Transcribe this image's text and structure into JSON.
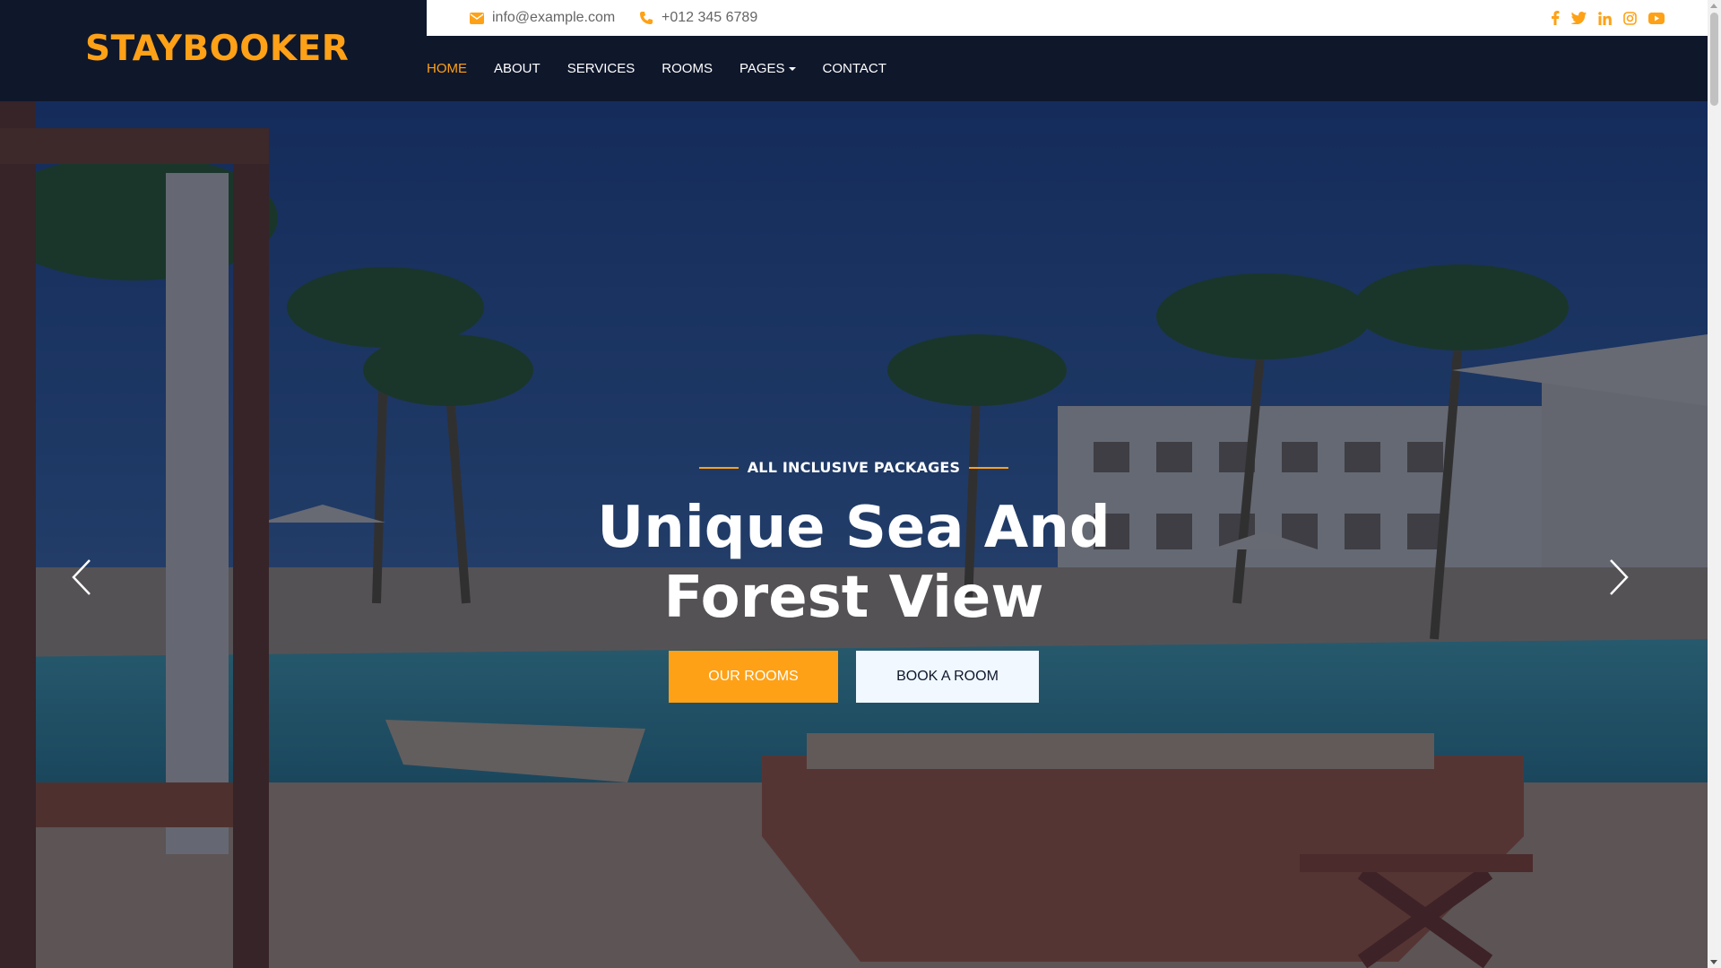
{
  "brand": "STAYBOOKER",
  "topbar": {
    "email": "info@example.com",
    "phone": "+012 345 6789",
    "socials": [
      "facebook-icon",
      "twitter-icon",
      "linkedin-icon",
      "instagram-icon",
      "youtube-icon"
    ]
  },
  "nav": {
    "items": [
      "HOME",
      "ABOUT",
      "SERVICES",
      "ROOMS",
      "PAGES",
      "CONTACT"
    ],
    "active": "HOME"
  },
  "hero": {
    "kicker": "ALL INCLUSIVE PACKAGES",
    "title_line1": "Unique Sea And",
    "title_line2": "Forest View",
    "primary_button": "OUR ROOMS",
    "secondary_button": "BOOK A ROOM",
    "prev_icon": "chevron-left-icon",
    "next_icon": "chevron-right-icon"
  },
  "colors": {
    "accent": "#fea116",
    "dark": "#0f172b",
    "light": "#f1f8ff"
  }
}
